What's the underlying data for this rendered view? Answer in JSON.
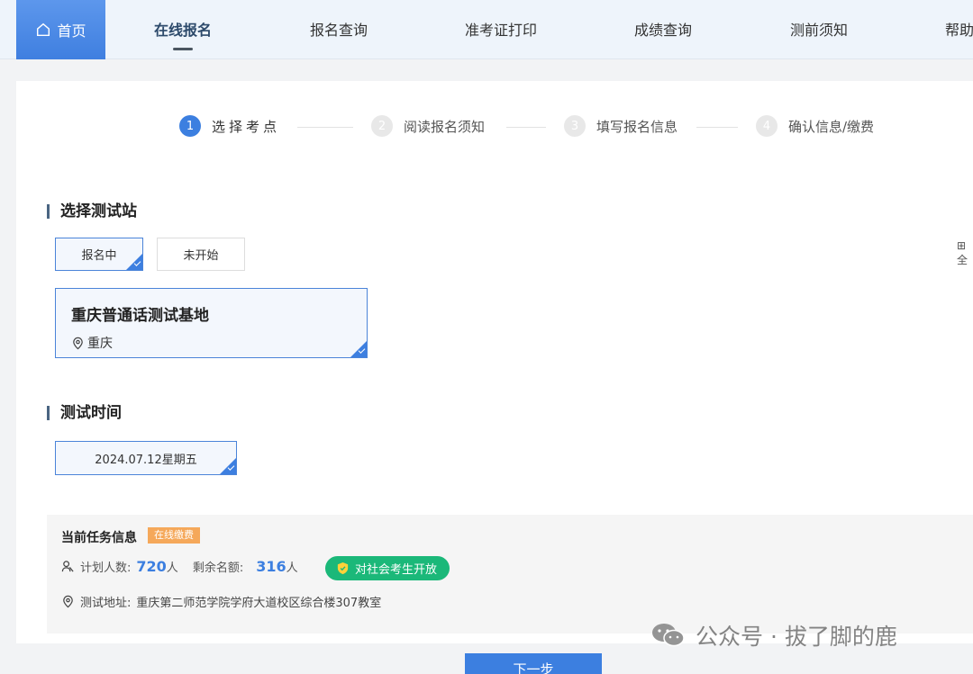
{
  "nav": {
    "home": "首页",
    "items": [
      "在线报名",
      "报名查询",
      "准考证打印",
      "成绩查询",
      "测前须知",
      "帮助"
    ]
  },
  "steps": [
    {
      "num": "1",
      "label": "选择考点"
    },
    {
      "num": "2",
      "label": "阅读报名须知"
    },
    {
      "num": "3",
      "label": "填写报名信息"
    },
    {
      "num": "4",
      "label": "确认信息/缴费"
    }
  ],
  "station": {
    "title": "选择测试站",
    "filters": [
      "报名中",
      "未开始"
    ],
    "site_name": "重庆普通话测试基地",
    "site_city": "重庆",
    "side_text": "全"
  },
  "time": {
    "title": "测试时间",
    "option": "2024.07.12星期五"
  },
  "task": {
    "title": "当前任务信息",
    "badge": "在线缴费",
    "plan_label": "计划人数:",
    "plan_value": "720",
    "unit": "人",
    "remain_label": "剩余名额:",
    "remain_value": "316",
    "open_label": "对社会考生开放",
    "address_label": "测试地址:",
    "address": "重庆第二师范学院学府大道校区综合楼307教室"
  },
  "watermark": "公众号 · 拔了脚的鹿",
  "next_button": "下一步",
  "colors": {
    "accent": "#3c7fe0",
    "green": "#1bb879",
    "orange": "#f5a85a"
  }
}
